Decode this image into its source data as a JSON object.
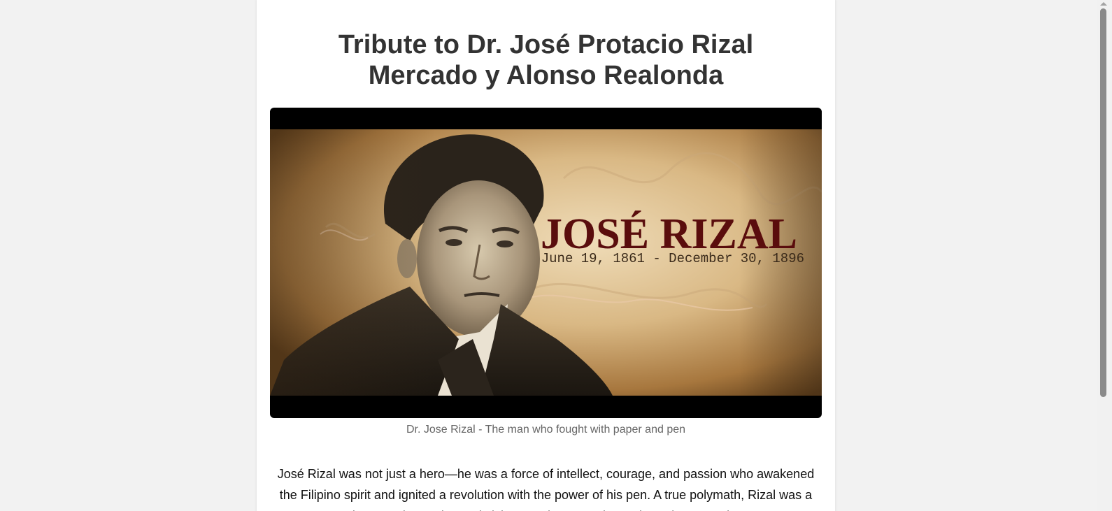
{
  "page": {
    "title_line1": "Tribute to Dr. José Protacio Rizal",
    "title_line2": "Mercado y Alonso Realonda"
  },
  "hero_image": {
    "overlay_name": "JOSÉ RIZAL",
    "overlay_dates": "June 19, 1861 - December 30, 1896"
  },
  "caption": "Dr. Jose Rizal - The man who fought with paper and pen",
  "intro_text": "José Rizal was not just a hero—he was a force of intellect, courage, and passion who awakened the Filipino spirit and ignited a revolution with the power of his pen. A true polymath, Rizal was a doctor, writer, artist, and visionary whose words cut through oppression",
  "colors": {
    "background": "#f2f2f2",
    "card": "#ffffff",
    "title": "#333333",
    "caption": "#666666",
    "overlay_name": "#5a0d0d"
  }
}
